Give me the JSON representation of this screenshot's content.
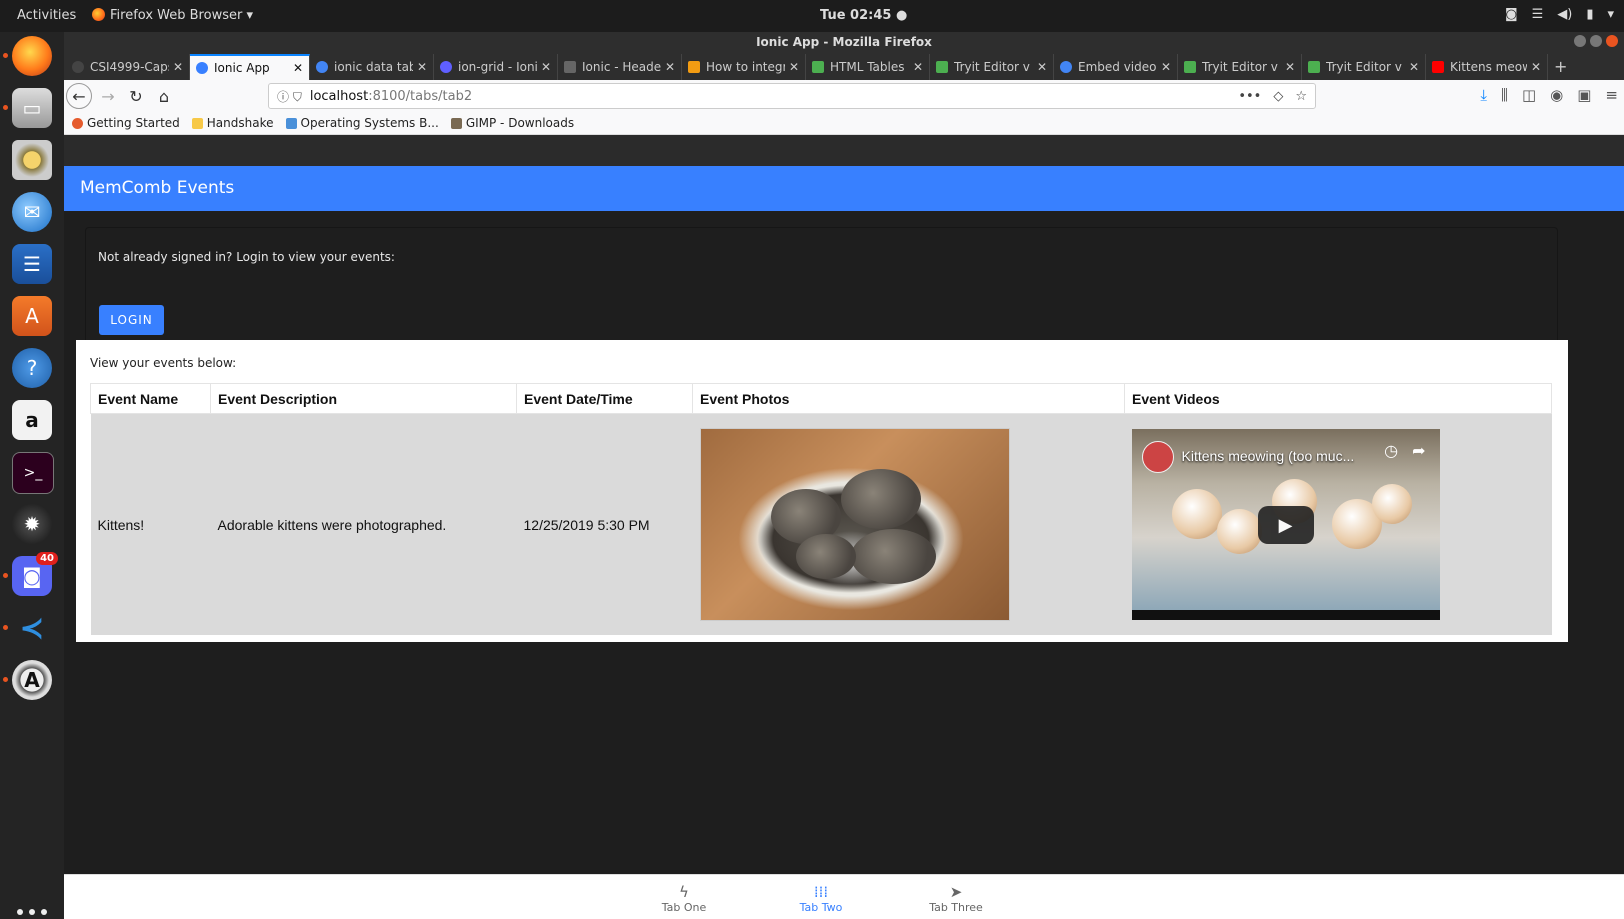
{
  "system": {
    "activities": "Activities",
    "app_menu": "Firefox Web Browser ▾",
    "clock": "Tue 02:45 ●"
  },
  "dock": {
    "notification_count": "40"
  },
  "window": {
    "title": "Ionic App - Mozilla Firefox"
  },
  "tabs": [
    {
      "title": "CSI4999-Caps",
      "color": "#444444"
    },
    {
      "title": "Ionic App",
      "color": "#3880ff"
    },
    {
      "title": "ionic data tab",
      "color": "#4285f4"
    },
    {
      "title": "ion-grid - Ionic",
      "color": "#5f5fff"
    },
    {
      "title": "Ionic - Header",
      "color": "#666666"
    },
    {
      "title": "How to integr",
      "color": "#f39c12"
    },
    {
      "title": "HTML Tables",
      "color": "#4caf50"
    },
    {
      "title": "Tryit Editor v",
      "color": "#4caf50"
    },
    {
      "title": "Embed video",
      "color": "#4285f4"
    },
    {
      "title": "Tryit Editor v",
      "color": "#4caf50"
    },
    {
      "title": "Tryit Editor v",
      "color": "#4caf50"
    },
    {
      "title": "Kittens meow",
      "color": "#ff0000"
    }
  ],
  "url": {
    "host": "localhost",
    "path": ":8100/tabs/tab2"
  },
  "bookmarks": [
    {
      "label": "Getting Started",
      "color": "#e55b2d"
    },
    {
      "label": "Handshake",
      "color": "#f7c948"
    },
    {
      "label": "Operating Systems B...",
      "color": "#4a90d9"
    },
    {
      "label": "GIMP - Downloads",
      "color": "#7a6a53"
    }
  ],
  "app": {
    "header_title": "MemComb Events",
    "signin_prompt": "Not already signed in? Login to view your events:",
    "login_label": "LOGIN",
    "events_intro": "View your events below:",
    "columns": [
      "Event Name",
      "Event Description",
      "Event Date/Time",
      "Event Photos",
      "Event Videos"
    ],
    "rows": [
      {
        "name": "Kittens!",
        "description": "Adorable kittens were photographed.",
        "datetime": "12/25/2019 5:30 PM",
        "video_title": "Kittens meowing (too muc..."
      }
    ]
  },
  "tabbar": [
    {
      "label": "Tab One",
      "icon": "flash-icon",
      "selected": false
    },
    {
      "label": "Tab Two",
      "icon": "apps-icon",
      "selected": true
    },
    {
      "label": "Tab Three",
      "icon": "send-icon",
      "selected": false
    }
  ]
}
